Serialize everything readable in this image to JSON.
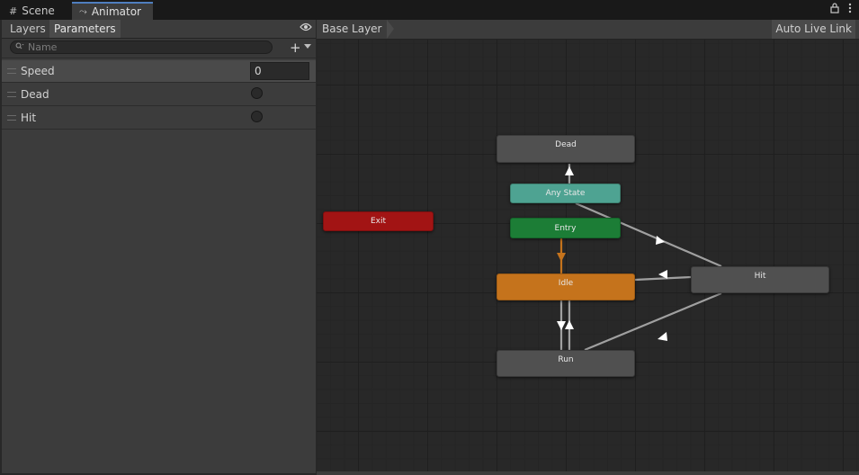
{
  "tabs": [
    {
      "label": "Scene",
      "icon": "grid-icon"
    },
    {
      "label": "Animator",
      "icon": "animator-icon"
    }
  ],
  "window_controls": {
    "lock_icon": "lock-icon",
    "menu_icon": "more-vertical-icon"
  },
  "left_panel": {
    "tabs": [
      "Layers",
      "Parameters"
    ],
    "active_tab": "Parameters",
    "visibility_icon": "eye-icon",
    "search": {
      "placeholder": "Name",
      "value": ""
    },
    "add_icon": "plus-icon",
    "parameters": [
      {
        "name": "Speed",
        "type": "float",
        "value": "0"
      },
      {
        "name": "Dead",
        "type": "trigger",
        "value": false
      },
      {
        "name": "Hit",
        "type": "trigger",
        "value": false
      }
    ]
  },
  "graph": {
    "breadcrumb": "Base Layer",
    "auto_live_link": "Auto Live Link",
    "states": {
      "dead": "Dead",
      "any_state": "Any State",
      "entry": "Entry",
      "exit": "Exit",
      "idle": "Idle",
      "hit": "Hit",
      "run": "Run"
    },
    "colors": {
      "default_state": "#505050",
      "any_state": "#4ea392",
      "entry": "#1c7d36",
      "exit": "#a21414",
      "default_layer_state": "#c5731c",
      "transition": "#a0a0a0",
      "default_transition": "#c5731c"
    }
  }
}
